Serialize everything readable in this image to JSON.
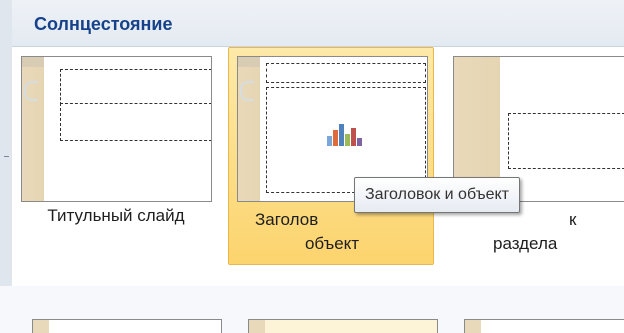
{
  "gallery": {
    "title": "Солнцестояние",
    "layouts": [
      {
        "name": "title-slide",
        "label_lines": [
          "Титульный слайд"
        ],
        "selected": false
      },
      {
        "name": "title-and-content",
        "label_lines": [
          "Заголов",
          "объект"
        ],
        "selected": true
      },
      {
        "name": "section-header",
        "label_lines": [
          "к",
          "раздела"
        ],
        "selected": false
      }
    ]
  },
  "tooltip": {
    "text": "Заголовок и объект"
  },
  "colors": {
    "title": "#15428b",
    "selection_top": "#fde9a8",
    "selection_bottom": "#fcd46e",
    "thumbnail_band": "#e8d9ba"
  },
  "icons": {
    "content_placeholder": "insert-content-icon"
  }
}
